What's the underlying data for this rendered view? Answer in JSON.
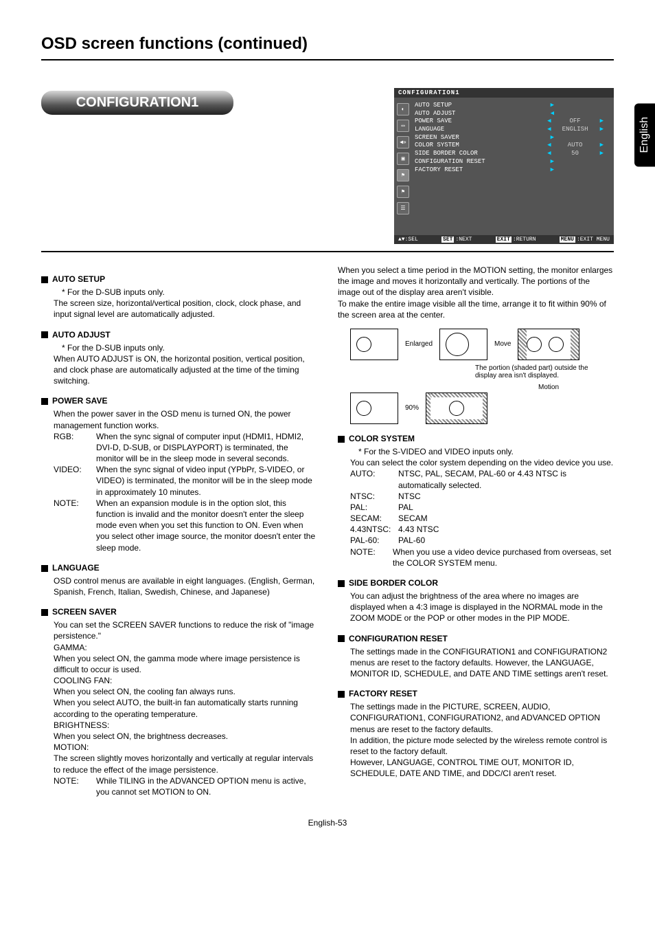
{
  "page_title": "OSD screen functions (continued)",
  "pill": "CONFIGURATION1",
  "side_tab": "English",
  "osd": {
    "title": "CONFIGURATION1",
    "rows": [
      {
        "label": "AUTO SETUP",
        "arrows": "▶",
        "val": ""
      },
      {
        "label": "AUTO ADJUST",
        "arrows": "◀",
        "val": ""
      },
      {
        "label": "POWER SAVE",
        "arrows": "◀",
        "val": "OFF",
        "rarrow": "▶"
      },
      {
        "label": "LANGUAGE",
        "arrows": "◀",
        "val": "ENGLISH",
        "rarrow": "▶"
      },
      {
        "label": "SCREEN SAVER",
        "arrows": "▶",
        "val": ""
      },
      {
        "label": "COLOR SYSTEM",
        "arrows": "◀",
        "val": "AUTO",
        "rarrow": "▶"
      },
      {
        "label": "SIDE BORDER COLOR",
        "arrows": "◀",
        "val": "50",
        "rarrow": "▶"
      },
      {
        "label": "CONFIGURATION RESET",
        "arrows": "▶",
        "val": ""
      },
      {
        "label": "FACTORY RESET",
        "arrows": "▶",
        "val": ""
      }
    ],
    "footer": {
      "sel": "▲▼:SEL",
      "next_tag": "SET",
      "next": ":NEXT",
      "return_tag": "EXIT",
      "return": ":RETURN",
      "menu_tag": "MENU",
      "menu": ":EXIT MENU"
    }
  },
  "left": {
    "auto_setup": {
      "title": "AUTO SETUP",
      "note": "* For the D-SUB inputs only.",
      "body": "The screen size, horizontal/vertical position, clock, clock phase, and input signal level are automatically adjusted."
    },
    "auto_adjust": {
      "title": "AUTO ADJUST",
      "note": "* For the D-SUB inputs only.",
      "body": "When AUTO ADJUST is ON, the horizontal position, vertical position, and clock phase are automatically adjusted at the time of the timing switching."
    },
    "power_save": {
      "title": "POWER SAVE",
      "intro": "When the power saver in the OSD menu is turned ON, the power management function works.",
      "rgb_k": "RGB:",
      "rgb_v": "When the sync signal of computer input (HDMI1, HDMI2, DVI-D, D-SUB, or DISPLAYPORT) is terminated, the monitor will be in the sleep mode in several seconds.",
      "video_k": "VIDEO:",
      "video_v": "When the sync signal of video input (YPbPr, S-VIDEO, or VIDEO) is terminated, the monitor will be in the sleep mode in approximately 10 minutes.",
      "note_k": "NOTE:",
      "note_v": "When an expansion module is in the option slot, this function is invalid and the monitor doesn't enter the sleep mode even when you set this function to ON. Even when you select other image source, the monitor doesn't enter the sleep mode."
    },
    "language": {
      "title": "LANGUAGE",
      "body": "OSD control menus are available in eight languages. (English, German, Spanish, French, Italian, Swedish, Chinese, and Japanese)"
    },
    "screen_saver": {
      "title": "SCREEN SAVER",
      "intro": "You can set the SCREEN SAVER functions to reduce the risk of \"image persistence.\"",
      "gamma_k": "GAMMA:",
      "gamma_v": "When you select ON, the gamma mode where image persistence is difficult to occur is used.",
      "fan_k": "COOLING FAN:",
      "fan_v1": "When you select ON, the cooling fan always runs.",
      "fan_v2": "When you select AUTO, the built-in fan automatically starts running according to the operating temperature.",
      "bright_k": "BRIGHTNESS:",
      "bright_v": "When you select ON, the brightness decreases.",
      "motion_k": "MOTION:",
      "motion_v": "The screen slightly moves horizontally and vertically at regular intervals to reduce the effect of the image persistence.",
      "note_k": "NOTE:",
      "note_v": "While TILING in the ADVANCED OPTION menu is active, you cannot set MOTION to ON."
    }
  },
  "right": {
    "motion_extra": {
      "p1": "When you select a time period in the MOTION setting, the monitor enlarges the image and moves it horizontally and vertically. The portions of the image out of the display area aren't visible.",
      "p2": "To make the entire image visible all the time, arrange it to fit within 90% of the screen area at the center.",
      "enlarged": "Enlarged",
      "move": "Move",
      "portion_note": "The portion (shaded part) outside the display area isn't displayed.",
      "motion_label": "Motion",
      "ninety": "90%"
    },
    "color_system": {
      "title": "COLOR SYSTEM",
      "note": "* For the S-VIDEO and VIDEO inputs only.",
      "intro": "You can select the color system depending on the video device you use.",
      "rows": [
        {
          "k": "AUTO:",
          "v": "NTSC, PAL, SECAM, PAL-60 or 4.43 NTSC is automatically selected."
        },
        {
          "k": "NTSC:",
          "v": "NTSC"
        },
        {
          "k": "PAL:",
          "v": "PAL"
        },
        {
          "k": "SECAM:",
          "v": "SECAM"
        },
        {
          "k": "4.43NTSC:",
          "v": "4.43 NTSC"
        },
        {
          "k": "PAL-60:",
          "v": "PAL-60"
        }
      ],
      "note2_k": "NOTE:",
      "note2_v": "When you use a video device purchased from overseas, set the COLOR SYSTEM menu."
    },
    "side_border": {
      "title": "SIDE BORDER COLOR",
      "body": "You can adjust the brightness of the area where no images are displayed when a 4:3 image is displayed in the NORMAL mode in the ZOOM MODE or the POP or other modes in the PIP MODE."
    },
    "config_reset": {
      "title": "CONFIGURATION RESET",
      "body": "The settings made in the CONFIGURATION1 and CONFIGURATION2 menus are reset to the factory defaults. However, the LANGUAGE, MONITOR ID, SCHEDULE, and DATE AND TIME settings aren't reset."
    },
    "factory_reset": {
      "title": "FACTORY RESET",
      "p1": "The settings made in the PICTURE, SCREEN, AUDIO, CONFIGURATION1, CONFIGURATION2, and ADVANCED OPTION menus are reset to the factory defaults.",
      "p2": "In addition, the picture mode selected by the wireless remote control is reset to the factory default.",
      "p3": "However, LANGUAGE, CONTROL TIME OUT, MONITOR ID, SCHEDULE, DATE AND TIME, and DDC/CI aren't reset."
    }
  },
  "page_number": "English-53"
}
